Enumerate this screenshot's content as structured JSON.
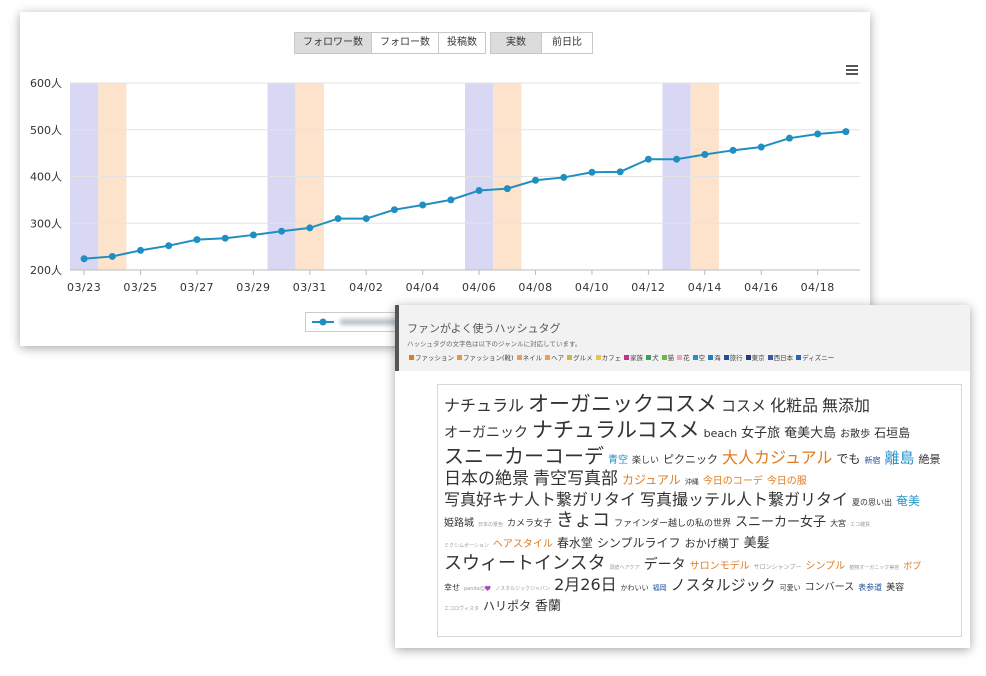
{
  "toolbar": {
    "metric_buttons": [
      "フォロワー数",
      "フォロー数",
      "投稿数"
    ],
    "mode_buttons": [
      "実数",
      "前日比"
    ]
  },
  "colors": {
    "line": "#1f8fc1",
    "weekend_sat": "#d8d8f4",
    "weekend_sun": "#fde3cc"
  },
  "chart_data": {
    "type": "line",
    "ylim": [
      200,
      600
    ],
    "y_ticks": [
      "200人",
      "300人",
      "400人",
      "500人",
      "600人"
    ],
    "x_ticks": [
      "03/23",
      "03/25",
      "03/27",
      "03/29",
      "03/31",
      "04/02",
      "04/04",
      "04/06",
      "04/08",
      "04/10",
      "04/12",
      "04/14",
      "04/16",
      "04/18"
    ],
    "x": [
      "03/23",
      "03/24",
      "03/25",
      "03/26",
      "03/27",
      "03/28",
      "03/29",
      "03/30",
      "03/31",
      "04/01",
      "04/02",
      "04/03",
      "04/04",
      "04/05",
      "04/06",
      "04/07",
      "04/08",
      "04/09",
      "04/10",
      "04/11",
      "04/12",
      "04/13",
      "04/14",
      "04/15",
      "04/16",
      "04/17",
      "04/18",
      "04/19"
    ],
    "series": [
      {
        "values": [
          224,
          229,
          242,
          252,
          265,
          268,
          275,
          283,
          290,
          310,
          310,
          329,
          339,
          350,
          370,
          374,
          392,
          398,
          409,
          410,
          437,
          437,
          447,
          456,
          463,
          482,
          491,
          496
        ]
      }
    ],
    "weekend_bands": [
      {
        "sat": "03/23",
        "sun": "03/24"
      },
      {
        "sat": "03/30",
        "sun": "03/31"
      },
      {
        "sat": "04/06",
        "sun": "04/07"
      },
      {
        "sat": "04/13",
        "sun": "04/14"
      }
    ]
  },
  "hashtags": {
    "title": "ファンがよく使うハッシュタグ",
    "subtitle": "ハッシュタグの文字色は以下のジャンルに対応しています。",
    "genres": [
      {
        "label": "ファッション",
        "color": "#e07b1e"
      },
      {
        "label": "ファッション(靴)",
        "color": "#e09a3e"
      },
      {
        "label": "ネイル",
        "color": "#e6a15a"
      },
      {
        "label": "ヘア",
        "color": "#f0a04b"
      },
      {
        "label": "グルメ",
        "color": "#d4b83a"
      },
      {
        "label": "カフェ",
        "color": "#e8c44a"
      },
      {
        "label": "家族",
        "color": "#c0328c"
      },
      {
        "label": "犬",
        "color": "#3aa05a"
      },
      {
        "label": "猫",
        "color": "#6cb84a"
      },
      {
        "label": "花",
        "color": "#f2a5b8"
      },
      {
        "label": "空",
        "color": "#2592c8"
      },
      {
        "label": "海",
        "color": "#1d7fc0"
      },
      {
        "label": "旅行",
        "color": "#1f4f9a"
      },
      {
        "label": "東京",
        "color": "#2a3a7a"
      },
      {
        "label": "西日本",
        "color": "#3a5aa0"
      },
      {
        "label": "ディズニー",
        "color": "#2a62b8"
      }
    ],
    "lines": [
      [
        {
          "text": "ナチュラル",
          "size": 16,
          "style": "dark"
        },
        {
          "text": "オーガニックコスメ",
          "size": 21,
          "style": "dark"
        },
        {
          "text": "コスメ",
          "size": 15,
          "style": "dark"
        },
        {
          "text": "化粧品",
          "size": 16,
          "style": "dark"
        },
        {
          "text": "無添加",
          "size": 16,
          "style": "dark"
        }
      ],
      [
        {
          "text": "オーガニック",
          "size": 14,
          "style": "dark"
        },
        {
          "text": "ナチュラルコスメ",
          "size": 21,
          "style": "dark"
        },
        {
          "text": "beach",
          "size": 11,
          "style": "dark"
        },
        {
          "text": "女子旅",
          "size": 13,
          "style": "dark"
        },
        {
          "text": "奄美大島",
          "size": 13,
          "style": "dark"
        },
        {
          "text": "お散歩",
          "size": 10,
          "style": "dark"
        },
        {
          "text": "石垣島",
          "size": 12,
          "style": "dark"
        }
      ],
      [
        {
          "text": "スニーカーコーデ",
          "size": 20,
          "style": "dark"
        },
        {
          "text": "青空",
          "size": 10,
          "style": "blue"
        },
        {
          "text": "楽しい",
          "size": 9,
          "style": "dark"
        },
        {
          "text": "ピクニック",
          "size": 11,
          "style": "dark"
        },
        {
          "text": "大人カジュアル",
          "size": 16,
          "style": "orange"
        },
        {
          "text": "でも",
          "size": 12,
          "style": "dark"
        },
        {
          "text": "新宿",
          "size": 8,
          "style": "navy"
        },
        {
          "text": "離島",
          "size": 15,
          "style": "blue"
        },
        {
          "text": "絶景",
          "size": 11,
          "style": "dark"
        }
      ],
      [
        {
          "text": "日本の絶景",
          "size": 17,
          "style": "dark"
        },
        {
          "text": "青空写真部",
          "size": 17,
          "style": "dark"
        },
        {
          "text": "カジュアル",
          "size": 12,
          "style": "orange"
        },
        {
          "text": "沖縄",
          "size": 7,
          "style": "dark"
        },
        {
          "text": "今日のコーデ",
          "size": 10,
          "style": "orange"
        },
        {
          "text": "今日の服",
          "size": 10,
          "style": "orange"
        }
      ],
      [
        {
          "text": "写真好キナ人ト繋ガリタイ",
          "size": 16,
          "style": "dark"
        },
        {
          "text": "写真撮ッテル人ト繋ガリタイ",
          "size": 16,
          "style": "dark"
        },
        {
          "text": "夏の思い出",
          "size": 8,
          "style": "dark"
        },
        {
          "text": "奄美",
          "size": 12,
          "style": "blue"
        }
      ],
      [
        {
          "text": "姫路城",
          "size": 10,
          "style": "dark"
        },
        {
          "text": "日本の景色",
          "size": 5,
          "style": "lgray"
        },
        {
          "text": "カメラ女子",
          "size": 9,
          "style": "dark"
        },
        {
          "text": "きょコ",
          "size": 18,
          "style": "dark"
        },
        {
          "text": "ファインダー越しの私の世界",
          "size": 9,
          "style": "dark"
        },
        {
          "text": "スニーカー女子",
          "size": 13,
          "style": "dark"
        },
        {
          "text": "大宮",
          "size": 8,
          "style": "dark"
        },
        {
          "text": "エコ雑貨",
          "size": 5,
          "style": "lgray"
        }
      ],
      [
        {
          "text": "ミクシムボーション",
          "size": 5,
          "style": "lgray"
        },
        {
          "text": "ヘアスタイル",
          "size": 10,
          "style": "orange"
        },
        {
          "text": "春水堂",
          "size": 12,
          "style": "dark"
        },
        {
          "text": "シンプルライフ",
          "size": 12,
          "style": "dark"
        },
        {
          "text": "おかげ横丁",
          "size": 11,
          "style": "dark"
        },
        {
          "text": "美髪",
          "size": 13,
          "style": "dark"
        }
      ],
      [
        {
          "text": "スウィートインスタ",
          "size": 18,
          "style": "dark"
        },
        {
          "text": "頭皮ヘアケア",
          "size": 5,
          "style": "lgray"
        },
        {
          "text": "データ",
          "size": 14,
          "style": "dark"
        },
        {
          "text": "サロンモデル",
          "size": 10,
          "style": "orange"
        },
        {
          "text": "サロンシャンプー",
          "size": 6,
          "style": "lgray"
        },
        {
          "text": "シンプル",
          "size": 10,
          "style": "orange"
        },
        {
          "text": "植物オーガニック美容",
          "size": 5,
          "style": "lgray"
        },
        {
          "text": "ボブ",
          "size": 9,
          "style": "orange"
        }
      ],
      [
        {
          "text": "幸せ",
          "size": 8,
          "style": "dark"
        },
        {
          "text": "panda😊💜",
          "size": 5,
          "style": "lgray"
        },
        {
          "text": "ノスタルジックジャパン",
          "size": 5,
          "style": "lgray"
        },
        {
          "text": "2月26日",
          "size": 16,
          "style": "dark"
        },
        {
          "text": "かわいい",
          "size": 7,
          "style": "dark"
        },
        {
          "text": "福岡",
          "size": 7,
          "style": "navy"
        },
        {
          "text": "ノスタルジック",
          "size": 15,
          "style": "dark"
        },
        {
          "text": "可愛い",
          "size": 7,
          "style": "dark"
        },
        {
          "text": "コンバース",
          "size": 10,
          "style": "dark"
        },
        {
          "text": "表参道",
          "size": 8,
          "style": "navy"
        },
        {
          "text": "美容",
          "size": 9,
          "style": "dark"
        }
      ],
      [
        {
          "text": "エコロヴィスタ",
          "size": 5,
          "style": "lgray"
        },
        {
          "text": "ハリポタ",
          "size": 12,
          "style": "dark"
        },
        {
          "text": "香蘭",
          "size": 13,
          "style": "dark"
        }
      ]
    ]
  }
}
